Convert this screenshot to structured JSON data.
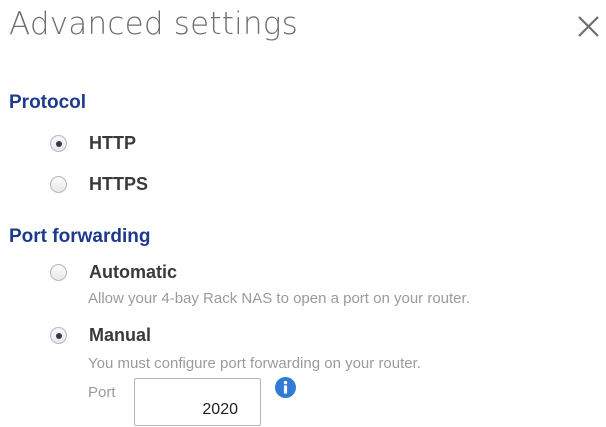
{
  "dialog": {
    "title": "Advanced settings",
    "close_icon": "close-icon"
  },
  "protocol": {
    "title": "Protocol",
    "options": [
      {
        "label": "HTTP",
        "checked": true
      },
      {
        "label": "HTTPS",
        "checked": false
      }
    ]
  },
  "port_forwarding": {
    "title": "Port forwarding",
    "options": [
      {
        "label": "Automatic",
        "checked": false,
        "help": "Allow your 4-bay Rack NAS to open a port on your router."
      },
      {
        "label": "Manual",
        "checked": true,
        "help": "You must configure port forwarding on your router."
      }
    ],
    "port_label": "Port",
    "port_value": "2020",
    "info_icon": "info-icon"
  },
  "colors": {
    "section_title": "#1d3a8c",
    "info_icon": "#2f7bd6",
    "radio_dot": "#2f3b55",
    "help_text": "#9b9b9b"
  }
}
